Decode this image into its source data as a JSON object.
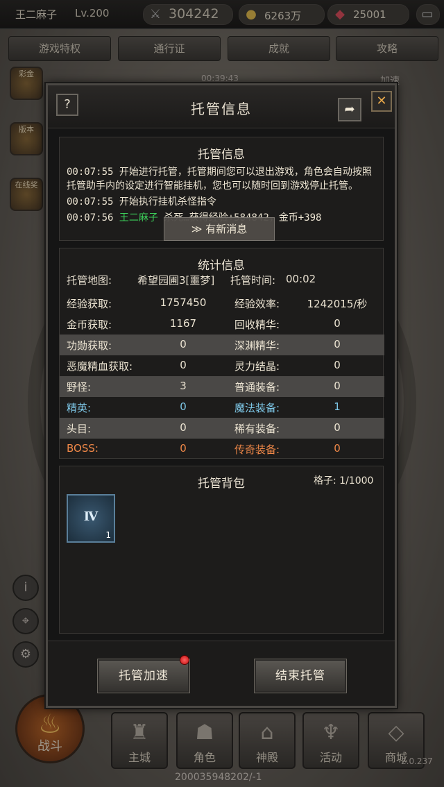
{
  "topbar": {
    "player_name": "王二麻子",
    "level": "Lv.200",
    "power": "304242",
    "gold": "6263万",
    "gems": "25001"
  },
  "menu": [
    "游戏特权",
    "通行证",
    "成就",
    "攻略"
  ],
  "background": {
    "timer": "00:39:43",
    "speed_label": "加速",
    "footer_id": "20003594820​2/-1",
    "footer_id_right": "2.0.237"
  },
  "side_icons": [
    "彩金",
    "版本",
    "在线奖"
  ],
  "bottom_nav": {
    "battle": "战斗",
    "items": [
      "主城",
      "角色",
      "神殿",
      "活动",
      "商城"
    ]
  },
  "dialog": {
    "title": "托管信息",
    "help": "?",
    "close": "✕",
    "log_panel": {
      "title": "托管信息",
      "lines": [
        {
          "time": "00:07:55",
          "text": "开始进行托管，托管期间您可以退出游戏，角色会自动按照托管助手内的设定进行智能挂机，您也可以随时回到游戏停止托管。"
        },
        {
          "time": "00:07:55",
          "text": "开始执行挂机杀怪指令"
        },
        {
          "time": "00:07:56",
          "name": "王二麻子",
          "text": "杀死…获得经验+584842，金币+398"
        }
      ],
      "new_message": "有新消息"
    },
    "stats_panel": {
      "title": "统计信息",
      "map_label": "托管地图:",
      "map_value": "希望园圃3[噩梦]",
      "time_label": "托管时间:",
      "time_value": "00:02",
      "rows": [
        {
          "k1": "经验获取:",
          "v1": "1757450",
          "k2": "经验效率:",
          "v2": "1242015/秒",
          "shade": false,
          "color": "white"
        },
        {
          "k1": "金币获取:",
          "v1": "1167",
          "k2": "回收精华:",
          "v2": "0",
          "shade": false,
          "color": "white"
        },
        {
          "k1": "功勋获取:",
          "v1": "0",
          "k2": "深渊精华:",
          "v2": "0",
          "shade": true,
          "color": "white"
        },
        {
          "k1": "恶魔精血获取:",
          "v1": "0",
          "k2": "灵力结晶:",
          "v2": "0",
          "shade": false,
          "color": "white"
        },
        {
          "k1": "野怪:",
          "v1": "3",
          "k2": "普通装备:",
          "v2": "0",
          "shade": true,
          "color": "white"
        },
        {
          "k1": "精英:",
          "v1": "0",
          "k2": "魔法装备:",
          "v2": "1",
          "shade": false,
          "color": "blue"
        },
        {
          "k1": "头目:",
          "v1": "0",
          "k2": "稀有装备:",
          "v2": "0",
          "shade": true,
          "color": "white"
        },
        {
          "k1": "BOSS:",
          "v1": "0",
          "k2": "传奇装备:",
          "v2": "0",
          "shade": false,
          "color": "orange"
        }
      ]
    },
    "bag_panel": {
      "title": "托管背包",
      "capacity": "格子: 1/1000",
      "items": [
        {
          "glyph": "Ⅳ",
          "count": "1"
        }
      ]
    },
    "buttons": {
      "speedup": "托管加速",
      "end": "结束托管"
    }
  }
}
